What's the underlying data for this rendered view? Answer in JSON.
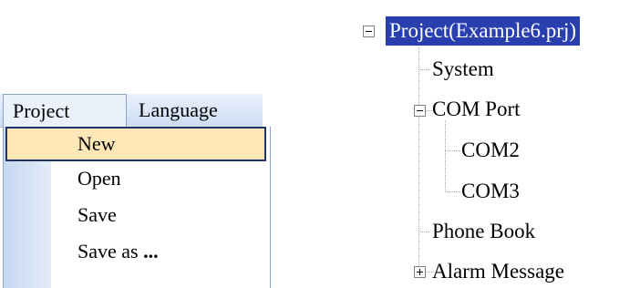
{
  "menubar": {
    "items": [
      {
        "label": "Project"
      },
      {
        "label": "Language"
      }
    ]
  },
  "dropdown": {
    "items": [
      {
        "label": "New",
        "highlighted": true
      },
      {
        "label": "Open"
      },
      {
        "label": "Save"
      },
      {
        "label": "Save as",
        "suffix": "..."
      }
    ]
  },
  "tree": {
    "root": {
      "label": "Project(Example6.prj)",
      "expander": "collapse",
      "selected": true
    },
    "nodes": [
      {
        "label": "System"
      },
      {
        "label": "COM Port",
        "expander": "collapse",
        "children": [
          {
            "label": "COM2"
          },
          {
            "label": "COM3"
          }
        ]
      },
      {
        "label": "Phone Book"
      },
      {
        "label": "Alarm Message",
        "expander": "expand"
      }
    ]
  },
  "colors": {
    "selection": "#2a3fae",
    "menu_highlight": "#fde7b6",
    "menu_highlight_border": "#22356b",
    "menubar": "#d8e4f6"
  }
}
